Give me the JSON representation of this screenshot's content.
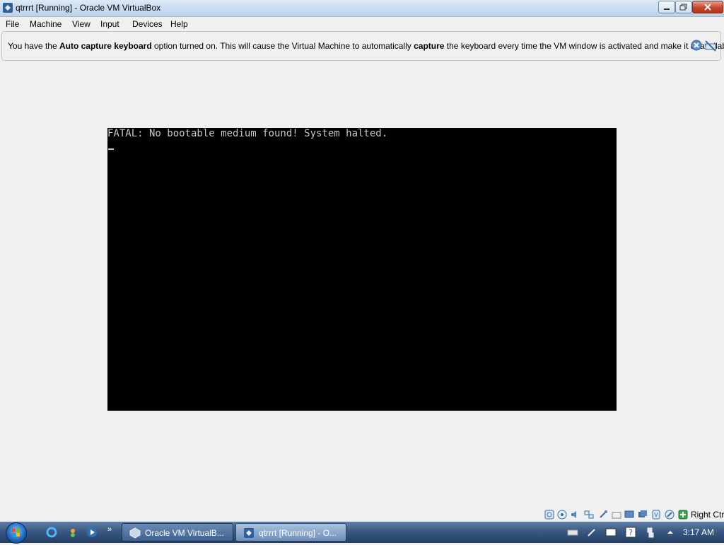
{
  "window": {
    "title": "qtrrrt [Running] - Oracle VM VirtualBox"
  },
  "menubar": {
    "items": [
      "File",
      "Machine",
      "View",
      "Input",
      "Devices",
      "Help"
    ]
  },
  "notice": {
    "part1": "You have the ",
    "bold1": "Auto capture keyboard",
    "part2": " option turned on. This will cause the Virtual Machine to automatically ",
    "bold2": "capture",
    "part3": " the keyboard every time the VM window is activated and make it unavailable to"
  },
  "vm": {
    "console_line": "FATAL: No bootable medium found! System halted.",
    "cursor": "_"
  },
  "statusbar": {
    "host_key": "Right Ctrl",
    "icons": [
      "hard-disk-icon",
      "optical-drive-icon",
      "audio-icon",
      "network-icon",
      "usb-icon",
      "shared-folders-icon",
      "display-icon",
      "video-capture-icon",
      "virtualization-icon",
      "mouse-integration-icon",
      "keyboard-capture-icon"
    ]
  },
  "taskbar": {
    "quick_launch_more": "»",
    "tasks": [
      {
        "label": "Oracle VM VirtualB..."
      },
      {
        "label": "qtrrrt [Running] - O..."
      }
    ],
    "clock": "3:17 AM"
  },
  "colors": {
    "vm_background": "#000000",
    "vm_text": "#c8c8c8",
    "taskbar": "#2f4e76",
    "titlebar": "#c9dcf0"
  }
}
